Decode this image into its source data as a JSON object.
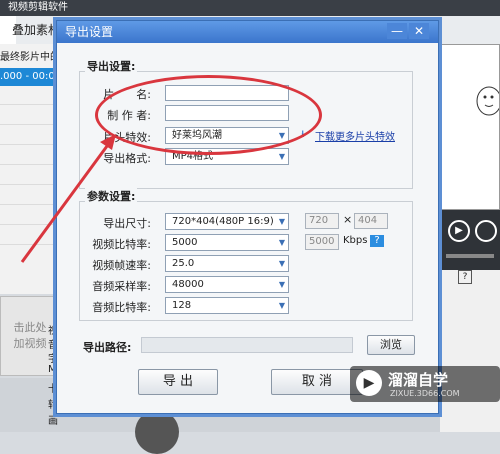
{
  "app": {
    "title": "视频剪辑软件",
    "tab_overlay": "叠加素材",
    "list_header": "最终影片中的",
    "list_row": ".000 - 00:0",
    "add_hint_line1": "击此处",
    "add_hint_line2": "加视频"
  },
  "right_panel": {
    "items": [
      "视",
      "音",
      "字",
      "M",
      "卡",
      "转",
      "画"
    ]
  },
  "dialog": {
    "title": "导出设置",
    "close_glyph": "✕",
    "min_glyph": "—",
    "export_group": {
      "label": "导出设置:",
      "name_label": "片　　名:",
      "name_value": "",
      "producer_label": "制 作 者:",
      "producer_value": "",
      "intro_label": "片头特效:",
      "intro_value": "好莱坞风潮",
      "download_link": "下载更多片头特效",
      "format_label": "导出格式:",
      "format_value": "MP4格式"
    },
    "params_group": {
      "label": "参数设置:",
      "size_label": "导出尺寸:",
      "size_value": "720*404(480P 16:9)",
      "width": "720",
      "times": "×",
      "height": "404",
      "vbitrate_label": "视频比特率:",
      "vbitrate_value": "5000",
      "vbitrate_box": "5000",
      "kbps": "Kbps",
      "help": "?",
      "fps_label": "视频帧速率:",
      "fps_value": "25.0",
      "samplerate_label": "音频采样率:",
      "samplerate_value": "48000",
      "abitrate_label": "音频比特率:",
      "abitrate_value": "128"
    },
    "path_label": "导出路径:",
    "path_value": "",
    "browse_button": "浏览",
    "export_button": "导 出",
    "cancel_button": "取 消"
  },
  "watermark": {
    "icon": "▶",
    "name": "溜溜自学",
    "url": "ZIXUE.3D66.COM"
  },
  "colors": {
    "accent": "#3b75cc",
    "annotation_red": "#d9363e",
    "selection_blue": "#1e88d6"
  }
}
